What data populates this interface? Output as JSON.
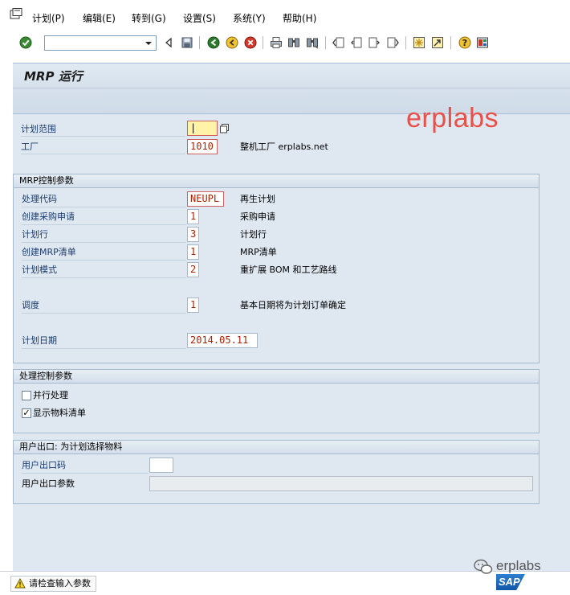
{
  "menu": {
    "items": [
      "计划(P)",
      "编辑(E)",
      "转到(G)",
      "设置(S)",
      "系统(Y)",
      "帮助(H)"
    ]
  },
  "toolbar": {
    "command_value": "",
    "icons": [
      "enter-icon",
      "back-icon",
      "save-icon",
      "back-green-icon",
      "exit-icon",
      "cancel-icon",
      "print-icon",
      "find-icon",
      "find-next-icon",
      "first-page-icon",
      "prev-page-icon",
      "next-page-icon",
      "last-page-icon",
      "new-session-icon",
      "shortcut-icon",
      "help-icon",
      "layout-icon"
    ]
  },
  "screen": {
    "title": "MRP 运行"
  },
  "watermark": "erplabs",
  "top_fields": {
    "scope_label": "计划范围",
    "scope_value": "",
    "plant_label": "工厂",
    "plant_value": "1010",
    "plant_desc": "整机工厂 erplabs.net"
  },
  "mrp_control": {
    "title": "MRP控制参数",
    "rows": [
      {
        "label": "处理代码",
        "value": "NEUPL",
        "desc": "再生计划"
      },
      {
        "label": "创建采购申请",
        "value": "1",
        "desc": "采购申请"
      },
      {
        "label": "计划行",
        "value": "3",
        "desc": "计划行"
      },
      {
        "label": "创建MRP清单",
        "value": "1",
        "desc": "MRP清单"
      },
      {
        "label": "计划模式",
        "value": "2",
        "desc": "重扩展 BOM 和工艺路线"
      },
      {
        "label": "调度",
        "value": "1",
        "desc": "基本日期将为计划订单确定"
      },
      {
        "label": "计划日期",
        "value": "2014.05.11",
        "desc": ""
      }
    ]
  },
  "process_control": {
    "title": "处理控制参数",
    "parallel_label": "并行处理",
    "parallel_checked": false,
    "show_list_label": "显示物料清单",
    "show_list_checked": true,
    "show_list_mark": "✓"
  },
  "user_exit": {
    "title": "用户出口: 为计划选择物料",
    "code_label": "用户出口码",
    "code_value": "",
    "param_label": "用户出口参数",
    "param_value": ""
  },
  "status": {
    "message": "请检查输入参数"
  },
  "footer": {
    "wechat_text": "erplabs",
    "sap_logo": "SAP"
  },
  "colors": {
    "watermark": "#e8504a",
    "field_text": "#b02000",
    "label": "#1a3b6e",
    "required_border": "#d06060",
    "focus_fill": "#fff3a8"
  }
}
